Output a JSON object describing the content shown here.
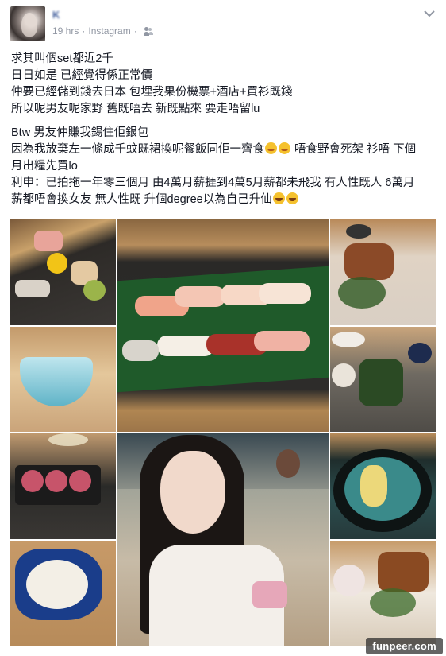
{
  "post": {
    "author_name": "K",
    "timestamp": "19 hrs",
    "separator": "·",
    "source": "Instagram",
    "privacy_icon": "friends-icon",
    "menu_icon": "chevron-down-icon"
  },
  "text": {
    "paragraph_1": [
      "求其叫個set都近2千",
      "日日如是 已經覺得係正常價",
      "仲要已經儲到錢去日本 包埋我果份機票+酒店+買衫既錢",
      "所以呢男友呢家野 舊既唔去 新既點來 要走唔留lu"
    ],
    "paragraph_2": {
      "line1": "Btw 男友仲賺我錫住佢銀包",
      "line2_a": "因為我放棄左一條成千蚊既裙換呢餐飯同佢一齊食",
      "line2_b": " 唔食野會死架 衫唔 下個",
      "line3": "月出糧先買lo",
      "line4": "利申：已拍拖一年零三個月 由4萬月薪捱到4萬5月薪都未飛我 有人性既人 6萬月",
      "line5": "薪都唔會換女友 無人性既 升個degree以為自己升仙"
    }
  },
  "photos": [
    {
      "name": "sashimi-plate-photo"
    },
    {
      "name": "blue-glass-cup-photo"
    },
    {
      "name": "sushi-platter-photo"
    },
    {
      "name": "grilled-fish-photo"
    },
    {
      "name": "appetizer-bowls-photo"
    },
    {
      "name": "tuna-tartare-photo"
    },
    {
      "name": "dessert-bowl-photo"
    },
    {
      "name": "selfie-woman-photo"
    },
    {
      "name": "clear-soup-bowl-photo"
    },
    {
      "name": "grilled-dish-photo"
    }
  ],
  "watermark": "funpeer.com",
  "colors": {
    "link": "#3b5998",
    "meta": "#9197a3",
    "text": "#141823"
  }
}
